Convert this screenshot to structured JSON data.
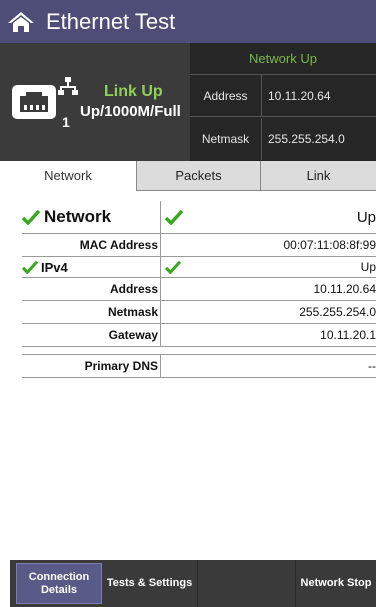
{
  "app": {
    "title": "Ethernet Test"
  },
  "icons": {
    "home": "home-icon",
    "port": "ethernet-port-icon",
    "network": "network-tree-icon",
    "check": "checkmark-icon"
  },
  "colors": {
    "titlebar": "#4d4d78",
    "link_up": "#8fd15a",
    "network_up": "#79b84a",
    "check": "#3aa81f"
  },
  "status": {
    "port_number": "1",
    "link_label": "Link Up",
    "link_speed": "Up/1000M/Full",
    "network_status": "Network Up",
    "address_key": "Address",
    "address_value": "10.11.20.64",
    "netmask_key": "Netmask",
    "netmask_value": "255.255.254.0"
  },
  "tabs": [
    {
      "label": "Network",
      "active": true
    },
    {
      "label": "Packets",
      "active": false
    },
    {
      "label": "Link",
      "active": false
    }
  ],
  "details": {
    "network": {
      "label": "Network",
      "value": "Up"
    },
    "mac": {
      "label": "MAC Address",
      "value": "00:07:11:08:8f:99"
    },
    "ipv4": {
      "label": "IPv4",
      "value": "Up"
    },
    "address": {
      "label": "Address",
      "value": "10.11.20.64"
    },
    "netmask": {
      "label": "Netmask",
      "value": "255.255.254.0"
    },
    "gateway": {
      "label": "Gateway",
      "value": "10.11.20.1"
    },
    "dns": {
      "label": "Primary DNS",
      "value": "--"
    }
  },
  "bottombar": {
    "connection_details": "Connection Details",
    "tests_settings": "Tests & Settings",
    "network_stop": "Network Stop"
  }
}
